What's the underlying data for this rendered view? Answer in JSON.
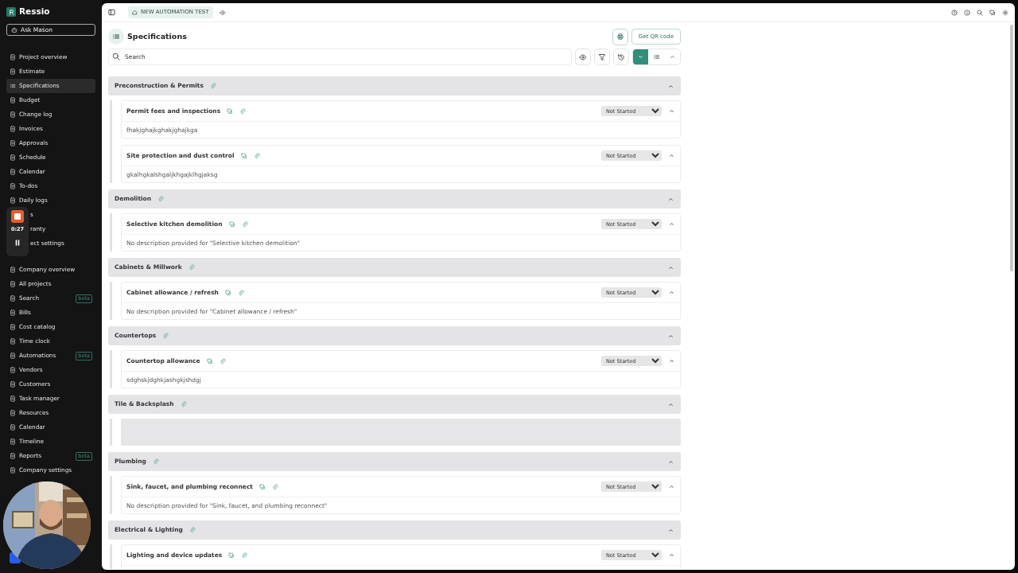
{
  "app": {
    "name": "Ressio",
    "ask_button": "Ask Mason"
  },
  "sidebar": {
    "project_items": [
      {
        "label": "Project overview",
        "selected": false
      },
      {
        "label": "Estimate",
        "selected": false
      },
      {
        "label": "Specifications",
        "selected": true
      },
      {
        "label": "Budget",
        "selected": false
      },
      {
        "label": "Change log",
        "selected": false
      },
      {
        "label": "Invoices",
        "selected": false
      },
      {
        "label": "Approvals",
        "selected": false
      },
      {
        "label": "Schedule",
        "selected": false
      },
      {
        "label": "Calendar",
        "selected": false
      },
      {
        "label": "To-dos",
        "selected": false
      },
      {
        "label": "Daily logs",
        "selected": false
      },
      {
        "label": "s",
        "selected": false,
        "kind": "covered"
      },
      {
        "label": "ranty",
        "selected": false,
        "kind": "covered"
      },
      {
        "label": "ect settings",
        "selected": false,
        "kind": "covered"
      }
    ],
    "company_items": [
      {
        "label": "Company overview",
        "selected": false
      },
      {
        "label": "All projects",
        "selected": false
      },
      {
        "label": "Search",
        "selected": false,
        "badge": "beta"
      },
      {
        "label": "Bills",
        "selected": false
      },
      {
        "label": "Cost catalog",
        "selected": false
      },
      {
        "label": "Time clock",
        "selected": false
      },
      {
        "label": "Automations",
        "selected": false,
        "badge": "beta"
      },
      {
        "label": "Vendors",
        "selected": false
      },
      {
        "label": "Customers",
        "selected": false
      },
      {
        "label": "Task manager",
        "selected": false
      },
      {
        "label": "Resources",
        "selected": false
      },
      {
        "label": "Calendar",
        "selected": false
      },
      {
        "label": "Timeline",
        "selected": false
      },
      {
        "label": "Reports",
        "selected": false,
        "badge": "beta"
      },
      {
        "label": "Company settings",
        "selected": false
      }
    ]
  },
  "recorder": {
    "time": "0:27"
  },
  "topbar": {
    "project_chip": "NEW AUTOMATION TEST"
  },
  "page": {
    "title": "Specifications",
    "qr_button": "Get QR code",
    "search": {
      "placeholder": "Search"
    },
    "view_modes": [
      {
        "kind": "expand",
        "selected": true
      },
      {
        "kind": "list",
        "selected": false
      },
      {
        "kind": "collapse",
        "selected": false
      }
    ]
  },
  "sections": [
    {
      "title": "Preconstruction & Permits",
      "expanded": true,
      "items": [
        {
          "title": "Permit fees and inspections",
          "status": "Not Started",
          "expanded": true,
          "description": "fhakjghajkghakjghajkga"
        },
        {
          "title": "Site protection and dust control",
          "status": "Not Started",
          "expanded": true,
          "description": "gkalhgkalshgaljkhgajklhgjaksg"
        }
      ]
    },
    {
      "title": "Demolition",
      "expanded": true,
      "items": [
        {
          "title": "Selective kitchen demolition",
          "status": "Not Started",
          "expanded": true,
          "description": "No description provided for \"Selective kitchen demolition\""
        }
      ]
    },
    {
      "title": "Cabinets & Millwork",
      "expanded": true,
      "items": [
        {
          "title": "Cabinet allowance / refresh",
          "status": "Not Started",
          "expanded": true,
          "description": "No description provided for \"Cabinet allowance / refresh\""
        }
      ]
    },
    {
      "title": "Countertops",
      "expanded": true,
      "items": [
        {
          "title": "Countertop allowance",
          "status": "Not Started",
          "expanded": true,
          "description": "sdghskjdghkjashgkjshdgj"
        }
      ]
    },
    {
      "title": "Tile & Backsplash",
      "expanded": true,
      "loading": true
    },
    {
      "title": "Plumbing",
      "expanded": true,
      "items": [
        {
          "title": "Sink, faucet, and plumbing reconnect",
          "status": "Not Started",
          "expanded": true,
          "description": "No description provided for \"Sink, faucet, and plumbing reconnect\""
        }
      ]
    },
    {
      "title": "Electrical & Lighting",
      "expanded": true,
      "items": [
        {
          "title": "Lighting and device updates",
          "status": "Not Started",
          "expanded": true
        }
      ]
    }
  ]
}
